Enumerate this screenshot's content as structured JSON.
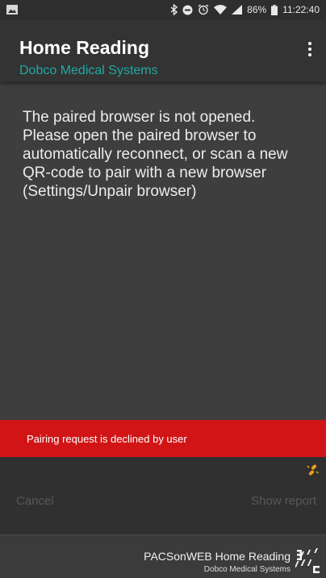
{
  "status_bar": {
    "battery": "86%",
    "time": "11:22:40",
    "icons": [
      "image-icon",
      "bluetooth-icon",
      "do-not-disturb-icon",
      "alarm-icon",
      "wifi-icon",
      "signal-icon",
      "battery-icon"
    ]
  },
  "app_bar": {
    "title": "Home Reading",
    "subtitle": "Dobco Medical Systems",
    "menu_icon": "more-vert-icon"
  },
  "main": {
    "message": "The paired browser is not opened. Please open the paired browser to automatically reconnect, or scan a new QR-code to pair with a new browser (Settings/Unpair browser)"
  },
  "snackbar": {
    "text": "Pairing request is declined by user"
  },
  "actions": {
    "link_icon": "link-broken-icon",
    "cancel_label": "Cancel",
    "show_report_label": "Show report"
  },
  "footer": {
    "product": "PACSonWEB Home Reading",
    "company": "Dobco Medical Systems",
    "logo_icon": "dobco-logo-icon"
  },
  "colors": {
    "background": "#3e3e3e",
    "app_bar": "#333333",
    "accent_teal": "#1fa9a3",
    "error_red": "#d11516",
    "disabled_text": "#585858",
    "link_icon_orange": "#f29a1b"
  }
}
